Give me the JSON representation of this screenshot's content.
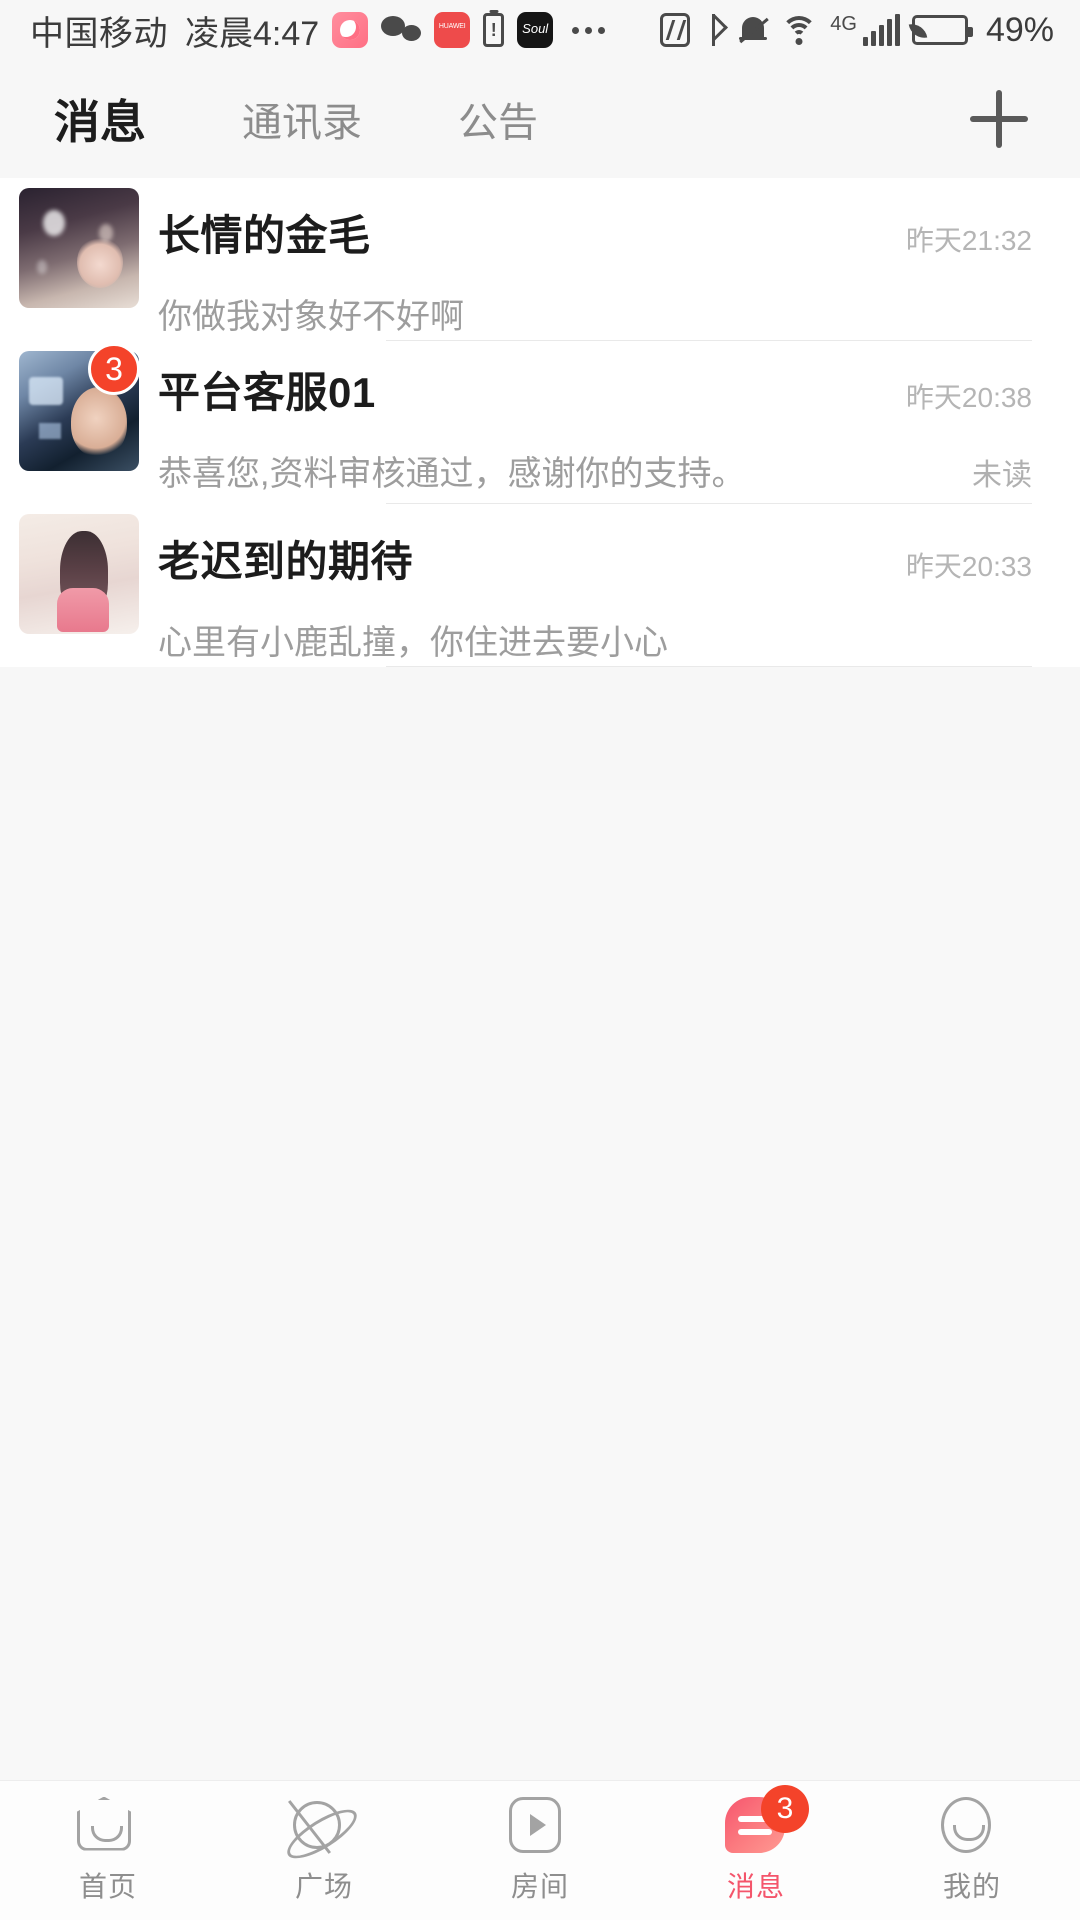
{
  "status_bar": {
    "carrier": "中国移动",
    "time": "凌晨4:47",
    "battery_percent": "49%",
    "network_type": "4G",
    "icons": [
      "soul-app-icon",
      "wechat-icon",
      "huawei-icon",
      "battery-low-icon",
      "soul-icon",
      "more-dots-icon",
      "nfc-icon",
      "bluetooth-icon",
      "silent-bell-icon",
      "wifi-icon",
      "signal-bars-icon",
      "battery-saver-icon"
    ]
  },
  "header": {
    "tabs": [
      {
        "label": "消息",
        "active": true
      },
      {
        "label": "通讯录",
        "active": false
      },
      {
        "label": "公告",
        "active": false
      }
    ],
    "add_button": "+"
  },
  "chat_list": [
    {
      "name": "长情的金毛",
      "message": "你做我对象好不好啊",
      "time": "昨天21:32",
      "unread_count": "",
      "state": ""
    },
    {
      "name": "平台客服01",
      "message": "恭喜您,资料审核通过，感谢你的支持。",
      "time": "昨天20:38",
      "unread_count": "3",
      "state": "未读"
    },
    {
      "name": "老迟到的期待",
      "message": "心里有小鹿乱撞，你住进去要小心",
      "time": "昨天20:33",
      "unread_count": "",
      "state": ""
    }
  ],
  "bottom_nav": [
    {
      "label": "首页",
      "icon": "home-icon",
      "active": false,
      "badge": ""
    },
    {
      "label": "广场",
      "icon": "planet-icon",
      "active": false,
      "badge": ""
    },
    {
      "label": "房间",
      "icon": "room-play-icon",
      "active": false,
      "badge": ""
    },
    {
      "label": "消息",
      "icon": "message-bubble-icon",
      "active": true,
      "badge": "3"
    },
    {
      "label": "我的",
      "icon": "profile-face-icon",
      "active": false,
      "badge": ""
    }
  ],
  "colors": {
    "accent": "#f4556b",
    "badge": "#f4432a",
    "header_bg": "#f7f7f7",
    "list_bg": "#ffffff",
    "empty_bg": "#f8f8f8",
    "muted_text": "#9d9d9d"
  }
}
